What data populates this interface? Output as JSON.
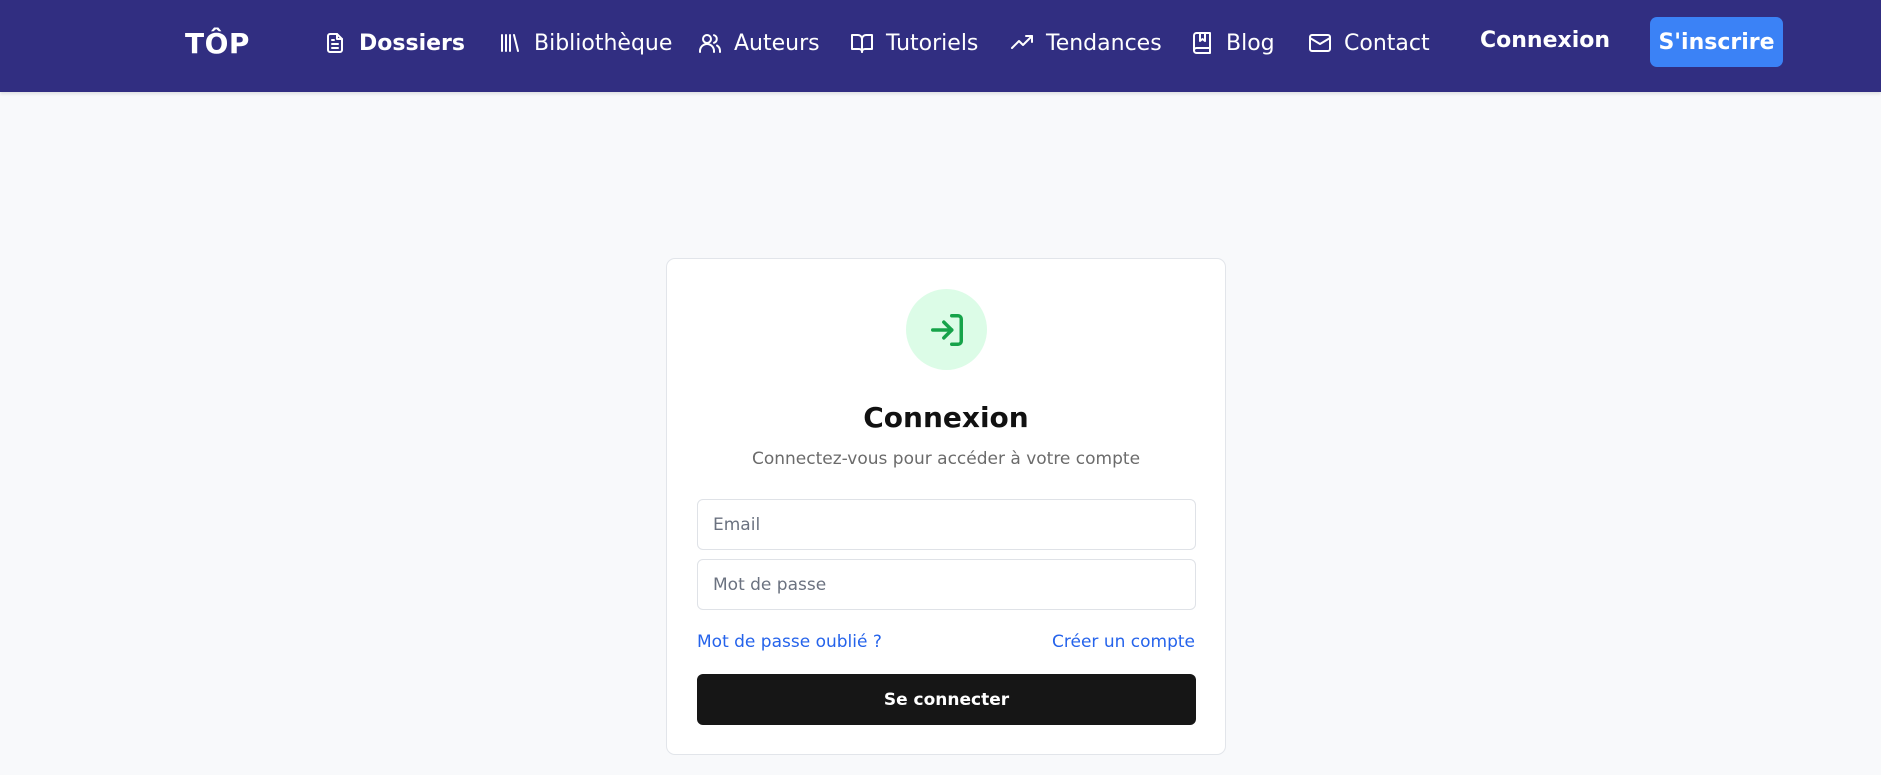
{
  "nav": {
    "logo": "TÔP",
    "items": [
      {
        "label": "Dossiers",
        "icon": "file-text-icon"
      },
      {
        "label": "Bibliothèque",
        "icon": "library-icon"
      },
      {
        "label": "Auteurs",
        "icon": "users-icon"
      },
      {
        "label": "Tutoriels",
        "icon": "book-open-icon"
      },
      {
        "label": "Tendances",
        "icon": "trending-up-icon"
      },
      {
        "label": "Blog",
        "icon": "book-marked-icon"
      },
      {
        "label": "Contact",
        "icon": "mail-icon"
      }
    ],
    "login_label": "Connexion",
    "signup_label": "S'inscrire"
  },
  "login_card": {
    "icon": "log-in-icon",
    "title": "Connexion",
    "subtitle": "Connectez-vous pour accéder à votre compte",
    "email": {
      "placeholder": "Email",
      "value": ""
    },
    "password": {
      "placeholder": "Mot de passe",
      "value": ""
    },
    "forgot_password_label": "Mot de passe oublié ?",
    "create_account_label": "Créer un compte",
    "submit_label": "Se connecter"
  },
  "colors": {
    "nav_background": "#312e81",
    "signup_button": "#3b82f6",
    "link": "#2563eb",
    "icon_circle": "#dcfce7",
    "icon_stroke": "#16a34a",
    "submit_button": "#161616",
    "page_background": "#f8f9fb"
  }
}
